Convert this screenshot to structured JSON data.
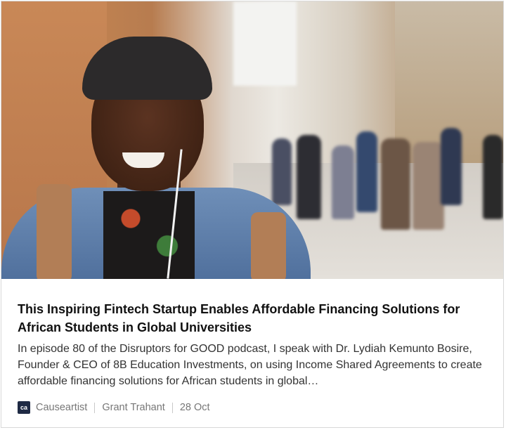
{
  "article": {
    "title": "This Inspiring Fintech Startup Enables Affordable Financing Solutions for African Students in Global Universities",
    "description": "In episode 80 of the Disruptors for GOOD podcast, I speak with Dr. Lydiah Kemunto Bosire, Founder & CEO of 8B Education Investments, on using Income Shared Agreements to create affordable financing solutions for African students in global…",
    "image_alt": "Smiling young man with dreadlocks and beanie on a busy street"
  },
  "meta": {
    "source_logo_text": "ca",
    "source": "Causeartist",
    "author": "Grant Trahant",
    "date": "28 Oct"
  },
  "colors": {
    "title": "#111111",
    "text": "#333333",
    "meta": "#777777",
    "logo_bg": "#1f2a44"
  }
}
